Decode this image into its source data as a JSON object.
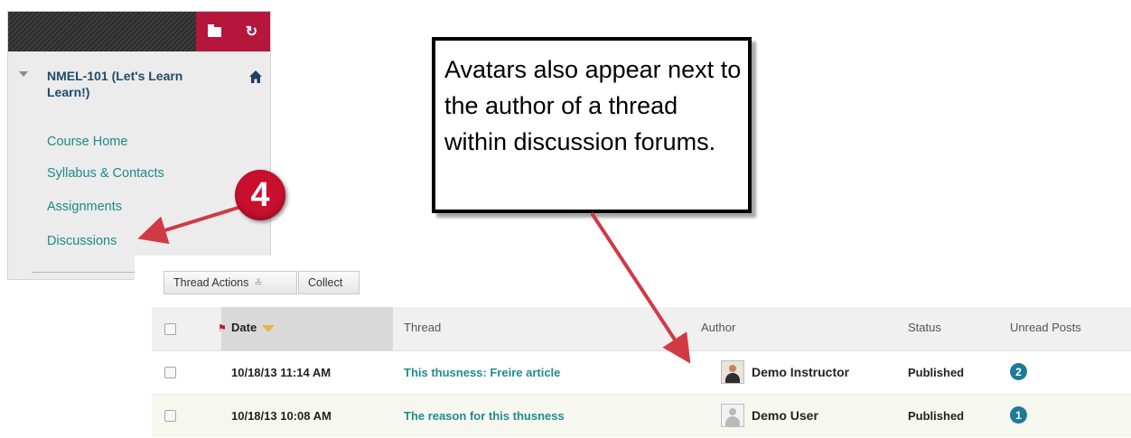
{
  "course_menu": {
    "course_title": "NMEL-101 (Let's Learn Learn!)",
    "links": [
      "Course Home",
      "Syllabus & Contacts",
      "Assignments",
      "Discussions"
    ]
  },
  "callout": {
    "text": "Avatars also appear next to the author of a thread within discussion forums."
  },
  "step_badge": "4",
  "toolbar": {
    "thread_actions_label": "Thread Actions",
    "collect_label": "Collect"
  },
  "table": {
    "columns": [
      "Date",
      "Thread",
      "Author",
      "Status",
      "Unread Posts"
    ],
    "rows": [
      {
        "date": "10/18/13 11:14 AM",
        "thread": "This thusness: Freire article",
        "author": "Demo Instructor",
        "status": "Published",
        "unread": "2"
      },
      {
        "date": "10/18/13 10:08 AM",
        "thread": "The reason for this thusness",
        "author": "Demo User",
        "status": "Published",
        "unread": "1"
      }
    ]
  },
  "colors": {
    "accent_red": "#c8102e",
    "link_teal": "#1a8a8a",
    "count_blue": "#1e7a99"
  }
}
